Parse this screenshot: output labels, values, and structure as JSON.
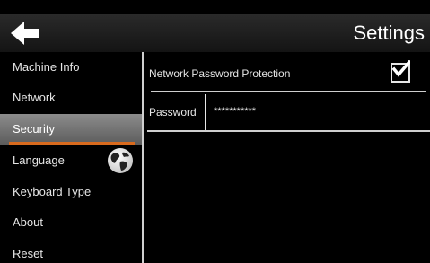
{
  "header": {
    "title": "Settings",
    "back_icon": "arrow-left-icon"
  },
  "sidebar": {
    "items": [
      {
        "label": "Machine Info"
      },
      {
        "label": "Network"
      },
      {
        "label": "Security",
        "active": true
      },
      {
        "label": "Language",
        "icon": "globe-icon"
      },
      {
        "label": "Keyboard Type"
      },
      {
        "label": "About"
      },
      {
        "label": "Reset"
      }
    ]
  },
  "security": {
    "protection_label": "Network Password Protection",
    "protection_checked": true,
    "password_label": "Password",
    "password_value": "***********"
  },
  "colors": {
    "accent": "#d86a1e",
    "active_bg": "#7a7a7a",
    "text": "#e6e6e6"
  }
}
